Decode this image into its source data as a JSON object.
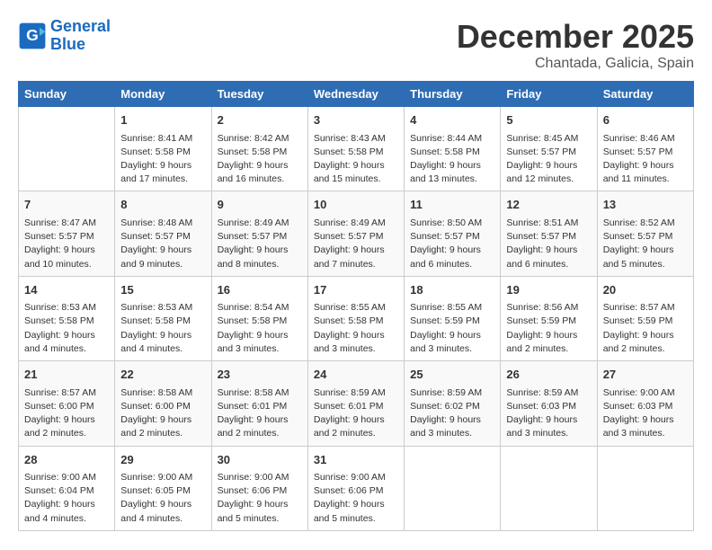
{
  "header": {
    "logo_line1": "General",
    "logo_line2": "Blue",
    "month": "December 2025",
    "location": "Chantada, Galicia, Spain"
  },
  "weekdays": [
    "Sunday",
    "Monday",
    "Tuesday",
    "Wednesday",
    "Thursday",
    "Friday",
    "Saturday"
  ],
  "weeks": [
    [
      {
        "day": "",
        "sunrise": "",
        "sunset": "",
        "daylight": ""
      },
      {
        "day": "1",
        "sunrise": "8:41 AM",
        "sunset": "5:58 PM",
        "daylight": "9 hours and 17 minutes."
      },
      {
        "day": "2",
        "sunrise": "8:42 AM",
        "sunset": "5:58 PM",
        "daylight": "9 hours and 16 minutes."
      },
      {
        "day": "3",
        "sunrise": "8:43 AM",
        "sunset": "5:58 PM",
        "daylight": "9 hours and 15 minutes."
      },
      {
        "day": "4",
        "sunrise": "8:44 AM",
        "sunset": "5:58 PM",
        "daylight": "9 hours and 13 minutes."
      },
      {
        "day": "5",
        "sunrise": "8:45 AM",
        "sunset": "5:57 PM",
        "daylight": "9 hours and 12 minutes."
      },
      {
        "day": "6",
        "sunrise": "8:46 AM",
        "sunset": "5:57 PM",
        "daylight": "9 hours and 11 minutes."
      }
    ],
    [
      {
        "day": "7",
        "sunrise": "8:47 AM",
        "sunset": "5:57 PM",
        "daylight": "9 hours and 10 minutes."
      },
      {
        "day": "8",
        "sunrise": "8:48 AM",
        "sunset": "5:57 PM",
        "daylight": "9 hours and 9 minutes."
      },
      {
        "day": "9",
        "sunrise": "8:49 AM",
        "sunset": "5:57 PM",
        "daylight": "9 hours and 8 minutes."
      },
      {
        "day": "10",
        "sunrise": "8:49 AM",
        "sunset": "5:57 PM",
        "daylight": "9 hours and 7 minutes."
      },
      {
        "day": "11",
        "sunrise": "8:50 AM",
        "sunset": "5:57 PM",
        "daylight": "9 hours and 6 minutes."
      },
      {
        "day": "12",
        "sunrise": "8:51 AM",
        "sunset": "5:57 PM",
        "daylight": "9 hours and 6 minutes."
      },
      {
        "day": "13",
        "sunrise": "8:52 AM",
        "sunset": "5:57 PM",
        "daylight": "9 hours and 5 minutes."
      }
    ],
    [
      {
        "day": "14",
        "sunrise": "8:53 AM",
        "sunset": "5:58 PM",
        "daylight": "9 hours and 4 minutes."
      },
      {
        "day": "15",
        "sunrise": "8:53 AM",
        "sunset": "5:58 PM",
        "daylight": "9 hours and 4 minutes."
      },
      {
        "day": "16",
        "sunrise": "8:54 AM",
        "sunset": "5:58 PM",
        "daylight": "9 hours and 3 minutes."
      },
      {
        "day": "17",
        "sunrise": "8:55 AM",
        "sunset": "5:58 PM",
        "daylight": "9 hours and 3 minutes."
      },
      {
        "day": "18",
        "sunrise": "8:55 AM",
        "sunset": "5:59 PM",
        "daylight": "9 hours and 3 minutes."
      },
      {
        "day": "19",
        "sunrise": "8:56 AM",
        "sunset": "5:59 PM",
        "daylight": "9 hours and 2 minutes."
      },
      {
        "day": "20",
        "sunrise": "8:57 AM",
        "sunset": "5:59 PM",
        "daylight": "9 hours and 2 minutes."
      }
    ],
    [
      {
        "day": "21",
        "sunrise": "8:57 AM",
        "sunset": "6:00 PM",
        "daylight": "9 hours and 2 minutes."
      },
      {
        "day": "22",
        "sunrise": "8:58 AM",
        "sunset": "6:00 PM",
        "daylight": "9 hours and 2 minutes."
      },
      {
        "day": "23",
        "sunrise": "8:58 AM",
        "sunset": "6:01 PM",
        "daylight": "9 hours and 2 minutes."
      },
      {
        "day": "24",
        "sunrise": "8:59 AM",
        "sunset": "6:01 PM",
        "daylight": "9 hours and 2 minutes."
      },
      {
        "day": "25",
        "sunrise": "8:59 AM",
        "sunset": "6:02 PM",
        "daylight": "9 hours and 3 minutes."
      },
      {
        "day": "26",
        "sunrise": "8:59 AM",
        "sunset": "6:03 PM",
        "daylight": "9 hours and 3 minutes."
      },
      {
        "day": "27",
        "sunrise": "9:00 AM",
        "sunset": "6:03 PM",
        "daylight": "9 hours and 3 minutes."
      }
    ],
    [
      {
        "day": "28",
        "sunrise": "9:00 AM",
        "sunset": "6:04 PM",
        "daylight": "9 hours and 4 minutes."
      },
      {
        "day": "29",
        "sunrise": "9:00 AM",
        "sunset": "6:05 PM",
        "daylight": "9 hours and 4 minutes."
      },
      {
        "day": "30",
        "sunrise": "9:00 AM",
        "sunset": "6:06 PM",
        "daylight": "9 hours and 5 minutes."
      },
      {
        "day": "31",
        "sunrise": "9:00 AM",
        "sunset": "6:06 PM",
        "daylight": "9 hours and 5 minutes."
      },
      {
        "day": "",
        "sunrise": "",
        "sunset": "",
        "daylight": ""
      },
      {
        "day": "",
        "sunrise": "",
        "sunset": "",
        "daylight": ""
      },
      {
        "day": "",
        "sunrise": "",
        "sunset": "",
        "daylight": ""
      }
    ]
  ]
}
